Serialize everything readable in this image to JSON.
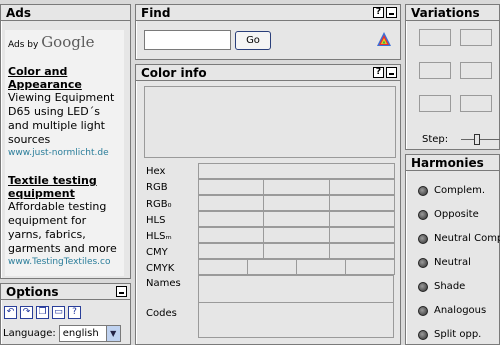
{
  "ads": {
    "title": "Ads",
    "ads_by": "Ads by",
    "google": "Google",
    "items": [
      {
        "title": "Color and Appearance",
        "text": "Viewing Equipment D65 using LED´s and multiple light sources",
        "url": "www.just-normlicht.de"
      },
      {
        "title": "Textile testing equipment",
        "text": "Affordable testing equipment for yarns, fabrics, garments and more",
        "url": "www.TestingTextiles.co"
      }
    ]
  },
  "options": {
    "title": "Options",
    "icons": [
      "undo-icon",
      "redo-icon",
      "copy-icon",
      "window-icon",
      "help-icon"
    ],
    "language_label": "Language:",
    "language_value": "english"
  },
  "find": {
    "title": "Find",
    "go_label": "Go",
    "input_value": ""
  },
  "color_info": {
    "title": "Color info",
    "labels": [
      "Hex",
      "RGB",
      "RGB₀",
      "HLS",
      "HLSₘ",
      "CMY",
      "CMYK",
      "Names",
      "Codes"
    ]
  },
  "variations": {
    "title": "Variations",
    "step_label": "Step:"
  },
  "harmonies": {
    "title": "Harmonies",
    "items": [
      "Complem.",
      "Opposite",
      "Neutral Comp",
      "Neutral",
      "Shade",
      "Analogous",
      "Split opp."
    ]
  },
  "header_buttons": {
    "help": "?"
  }
}
